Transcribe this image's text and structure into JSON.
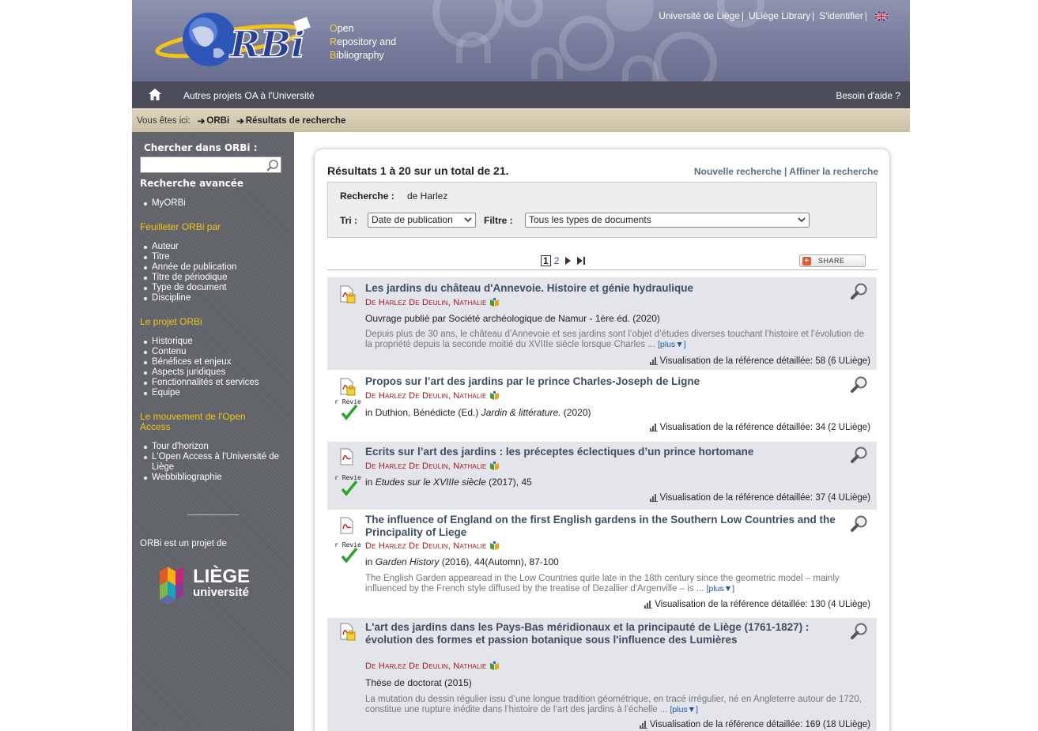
{
  "header": {
    "tagline": [
      {
        "initial": "O",
        "rest": "pen"
      },
      {
        "initial": "R",
        "rest": "epository and"
      },
      {
        "initial": "B",
        "rest": "ibliography"
      }
    ],
    "links": [
      {
        "label": "Université de Liège"
      },
      {
        "label": "ULiège Library"
      },
      {
        "label": "S'identifier"
      }
    ],
    "separator": "|"
  },
  "nav": {
    "projects": "Autres projets OA à l'Université",
    "help": "Besoin d'aide ?"
  },
  "breadcrumb": {
    "prefix": "Vous êtes ici:",
    "items": [
      "ORBi",
      "Résultats de recherche"
    ]
  },
  "sidebar": {
    "search_title": "Chercher dans ORBi :",
    "search_value": "",
    "advanced": "Recherche avancée",
    "myorbi": "MyORBi",
    "browse_title": "Feuilleter ORBi par",
    "browse": [
      "Auteur",
      "Titre",
      "Année de publication",
      "Titre de périodique",
      "Type de document",
      "Discipline"
    ],
    "project_title": "Le projet ORBi",
    "project": [
      "Historique",
      "Contenu",
      "Bénéfices et enjeux",
      "Aspects juridiques",
      "Fonctionnalités et services",
      "Equipe"
    ],
    "oa_title": "Le mouvement de l'Open Access",
    "oa": [
      "Tour d'horizon",
      "L'Open Access à l'Université de Liège",
      "Webbibliographie"
    ],
    "orbi_project": "ORBi est un projet de",
    "uliege_logo": {
      "line1": "LIÈGE",
      "line2": "université"
    }
  },
  "main": {
    "results_count": "Résultats 1 à 20 sur un total de 21.",
    "new_search": "Nouvelle recherche",
    "refine_search": "Affiner la recherche",
    "link_sep": "|",
    "query_label": "Recherche :",
    "query_value": "de Harlez",
    "sort_label": "Tri :",
    "sort_value": "Date de publication",
    "filter_label": "Filtre :",
    "filter_value": "Tous les types de documents",
    "pager": {
      "current": "1",
      "next_page": "2"
    },
    "share_label": "SHARE",
    "more_label": "[plus",
    "more_arrow": "▼]",
    "results": [
      {
        "title": "Les jardins du château d'Annevoie. Histoire et génie hydraulique",
        "author": "De Harlez De Deulin, Nathalie",
        "pub": "Ouvrage publié par Société archéologique de Namur - 1ère éd. (2020)",
        "abstract": "Depuis plus de 30 ans, le château d’Annevoie et ses jardins sont l’objet d’études diverses touchant l’histoire et l’évolution de la propriété depuis la seconde moitié du XVIIIe siècle lorsque Charles ...",
        "views": "Visualisation de la référence détaillée: 58 (6 ULiège)"
      },
      {
        "title": "Propos sur l’art des jardins par le prince Charles-Joseph de Ligne",
        "author": "De Harlez De Deulin, Nathalie",
        "pub_prefix": "in Duthion, Bénédicte (Ed.) ",
        "pub_italic": "Jardin & littérature.",
        "pub_suffix": " (2020)",
        "peer": "Peer Reviewed",
        "views": "Visualisation de la référence détaillée: 34 (2 ULiège)"
      },
      {
        "title": "Ecrits sur l’art des jardins : les préceptes éclectiques d’un prince hortomane",
        "author": "De Harlez De Deulin, Nathalie",
        "pub_prefix": "in ",
        "pub_italic": "Etudes sur le XVIIIe siècle",
        "pub_suffix": " (2017), 45",
        "peer": "Peer Reviewed",
        "views": "Visualisation de la référence détaillée: 37 (4 ULiège)"
      },
      {
        "title": "The influence of England on the first English gardens in the Southern Low Countries and the Principality of Liege",
        "author": "De Harlez De Deulin, Nathalie",
        "pub_prefix": "in ",
        "pub_italic": "Garden History",
        "pub_suffix": " (2016), 44(Automn), 87-100",
        "abstract": "The English Garden appearead in the Low Countries quite late in the 18th century since the geometric model – mainly influenced by the French style diffused by the treatise of Dezallier d'Argenville – is ...",
        "peer": "Peer Reviewed",
        "views": "Visualisation de la référence détaillée: 130 (4 ULiège)"
      },
      {
        "title": "L'art des jardins dans les Pays-Bas méridionaux et la principauté de Liège (1761-1827) : évolution des formes et passion botanique sous l'influence des Lumières",
        "author": "De Harlez De Deulin, Nathalie",
        "pub": "Thèse de doctorat (2015)",
        "abstract": "La mutation du dessin régulier issu d’une longue tradition géométrique, en tracé irrégulier, né en Angleterre autour de 1720, constitue une rupture inédite dans l’histoire de l’art des jardins à l’échelle ...",
        "views": "Visualisation de la référence détaillée: 169 (18 ULiège)"
      }
    ]
  },
  "colors": {
    "header": "#777c9c",
    "navbar": "#4b4d5a",
    "sidebar": "#606269",
    "sidebar_heading": "#f2c417",
    "title_link": "#3d4d63",
    "author": "#a1141d",
    "row_alt": "#e3e5ea"
  },
  "icons": [
    "orbi-logo",
    "uk-flag-icon",
    "home-icon",
    "arrow-right-icon",
    "search-icon",
    "pdf-icon",
    "peer-reviewed-icon",
    "author-profile-icon",
    "zoom-icon",
    "chart-icon",
    "next-page-icon",
    "last-page-icon",
    "share-plus-icon",
    "chevron-down-icon"
  ]
}
